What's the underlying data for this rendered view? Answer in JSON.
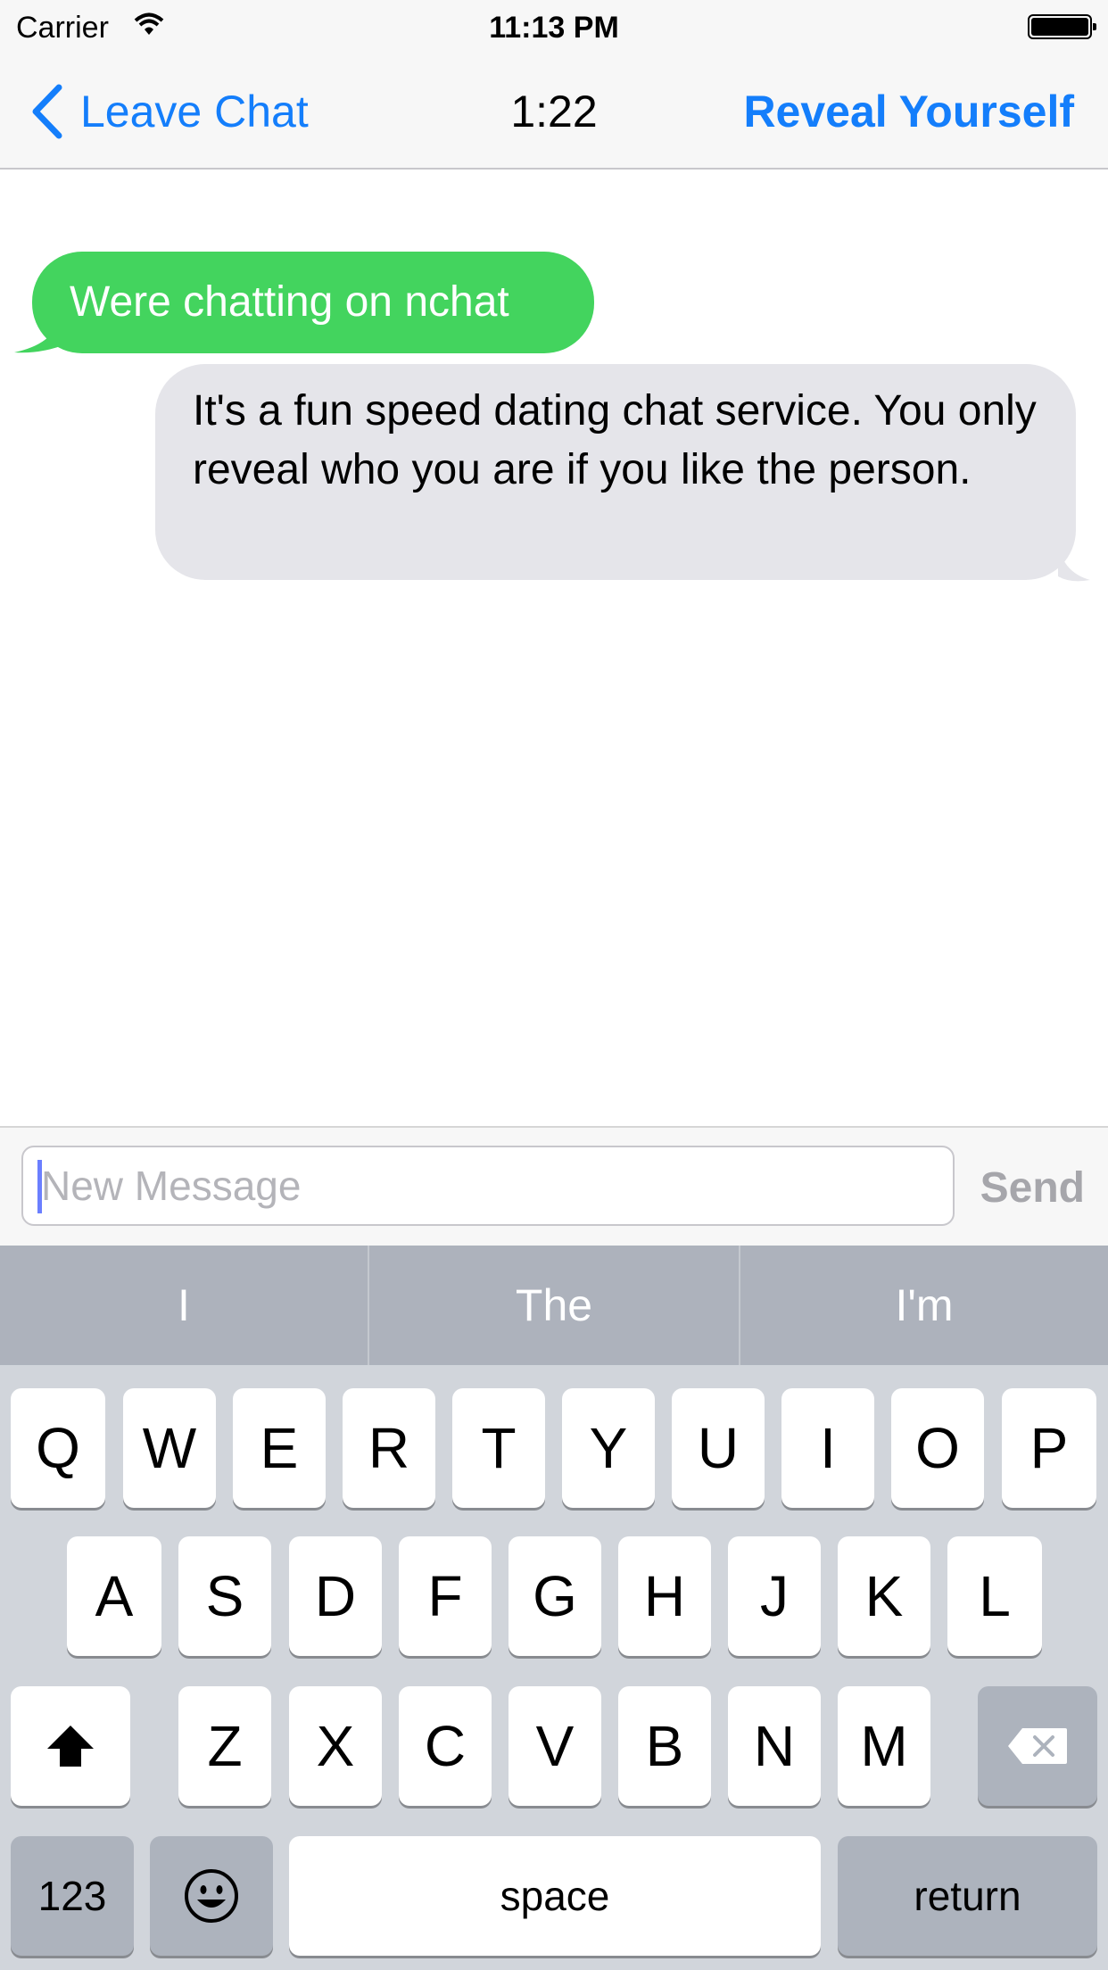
{
  "status_bar": {
    "carrier": "Carrier",
    "time": "11:13 PM"
  },
  "nav": {
    "back_label": "Leave Chat",
    "timer": "1:22",
    "reveal_label": "Reveal Yourself"
  },
  "messages": [
    {
      "text": "Were chatting on nchat",
      "color": "#43d45e"
    },
    {
      "text": "It's a fun speed dating chat service. You only reveal who you are if you like the person.",
      "color": "#e5e5ea"
    }
  ],
  "composer": {
    "placeholder": "New Message",
    "value": "",
    "send_label": "Send"
  },
  "keyboard": {
    "suggestions": [
      "I",
      "The",
      "I'm"
    ],
    "row1": [
      "Q",
      "W",
      "E",
      "R",
      "T",
      "Y",
      "U",
      "I",
      "O",
      "P"
    ],
    "row2": [
      "A",
      "S",
      "D",
      "F",
      "G",
      "H",
      "J",
      "K",
      "L"
    ],
    "row3": [
      "Z",
      "X",
      "C",
      "V",
      "B",
      "N",
      "M"
    ],
    "numbers_label": "123",
    "space_label": "space",
    "return_label": "return",
    "icons": {
      "shift": "shift-icon",
      "delete": "delete-icon",
      "emoji": "emoji-icon"
    }
  },
  "colors": {
    "accent": "#147efb",
    "sent_bubble": "#43d45e",
    "received_bubble": "#e5e5ea",
    "keyboard_bg": "#d1d5db"
  }
}
